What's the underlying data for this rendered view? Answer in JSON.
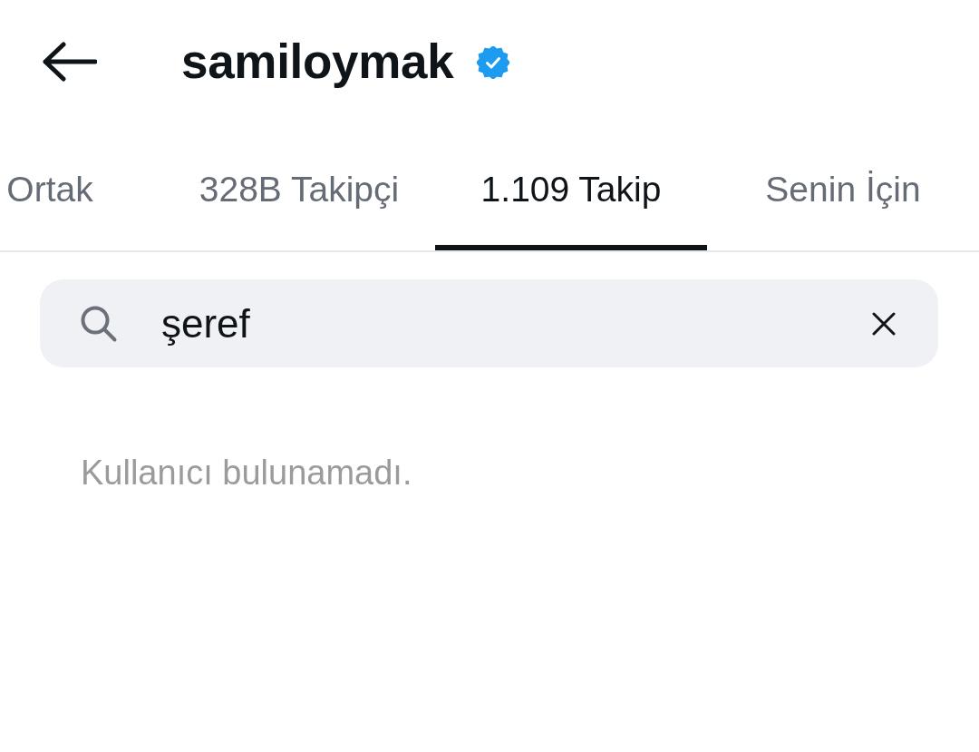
{
  "header": {
    "title": "samiloymak",
    "verified": true
  },
  "tabs": [
    {
      "label": "Ortak",
      "selected": false
    },
    {
      "label": "328B Takipçi",
      "selected": false
    },
    {
      "label": "1.109 Takip",
      "selected": true
    },
    {
      "label": "Senin İçin",
      "selected": false
    }
  ],
  "search": {
    "value": "şeref"
  },
  "empty_message": "Kullanıcı bulunamadı."
}
